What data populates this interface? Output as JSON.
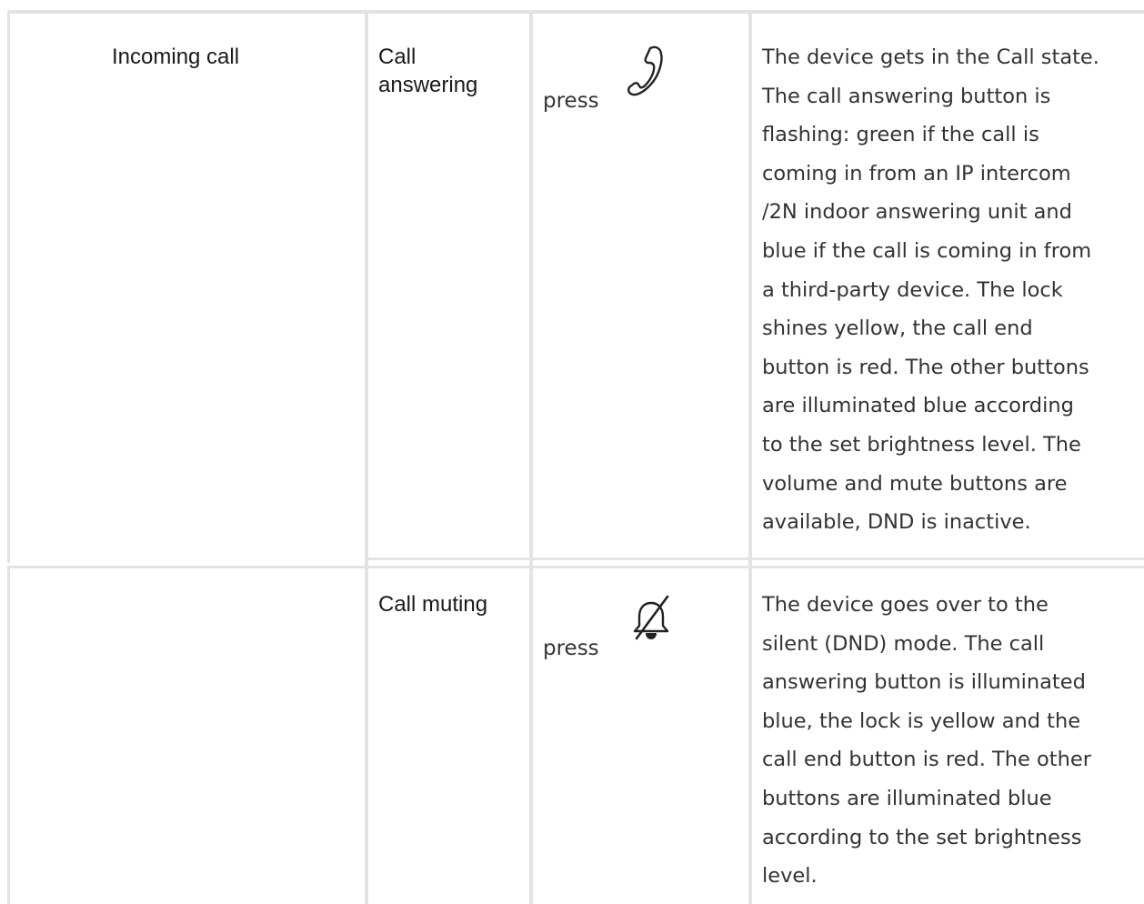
{
  "rows": [
    {
      "situation": "Incoming call",
      "action_lines": [
        "Call",
        "answering"
      ],
      "control_prefix": "press",
      "control_icon": "phone-handset-icon",
      "description_lines": [
        "The device gets in the Call state.",
        "The call answering button is",
        "flashing: green if the call is",
        "coming in from an IP intercom",
        "/2N indoor answering unit and",
        "blue if the call is coming in from",
        "a third-party device. The lock",
        "shines yellow, the call end",
        "button is red. The other buttons",
        "are illuminated blue according",
        "to the set brightness level. The",
        "volume and mute buttons are",
        "available, DND is inactive."
      ]
    },
    {
      "situation": "",
      "action_lines": [
        "Call muting"
      ],
      "control_prefix": "press",
      "control_icon": "bell-muted-icon",
      "description_lines": [
        "The device goes over to the",
        "silent (DND) mode. The call",
        "answering button is illuminated",
        "blue, the lock is yellow and the",
        "call end button is red. The other",
        "buttons are illuminated blue",
        "according to the set brightness",
        "level."
      ]
    }
  ],
  "colors": {
    "border": "#e3e3e3",
    "heading_text": "#1a1a1a",
    "body_text": "#333333"
  }
}
